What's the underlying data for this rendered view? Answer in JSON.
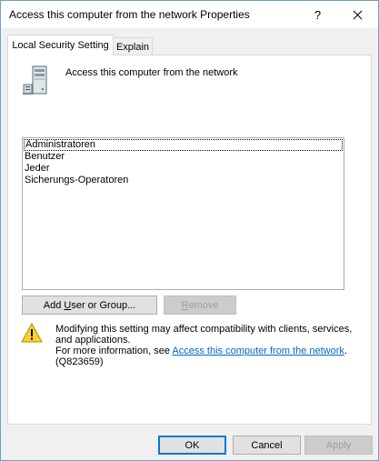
{
  "window": {
    "title": "Access this computer from the network Properties",
    "help_glyph": "?"
  },
  "tabs": [
    {
      "label": "Local Security Setting",
      "active": true
    },
    {
      "label": "Explain",
      "active": false
    }
  ],
  "policy": {
    "icon": "server-icon",
    "title": "Access this computer from the network"
  },
  "accounts": [
    "Administratoren",
    "Benutzer",
    "Jeder",
    "Sicherungs-Operatoren"
  ],
  "buttons": {
    "add_prefix": "Add ",
    "add_mnemonic": "U",
    "add_suffix": "ser or Group...",
    "remove_mnemonic": "R",
    "remove_suffix": "emove",
    "ok": "OK",
    "cancel": "Cancel",
    "apply": "Apply"
  },
  "warning": {
    "icon": "warning-icon",
    "line1": "Modifying this setting may affect compatibility with clients, services, and applications.",
    "more_prefix": "For more information, see ",
    "link_text": "Access this computer from the network",
    "more_suffix": ".",
    "kb": "(Q823659)",
    "link_color": "#0066cc"
  }
}
